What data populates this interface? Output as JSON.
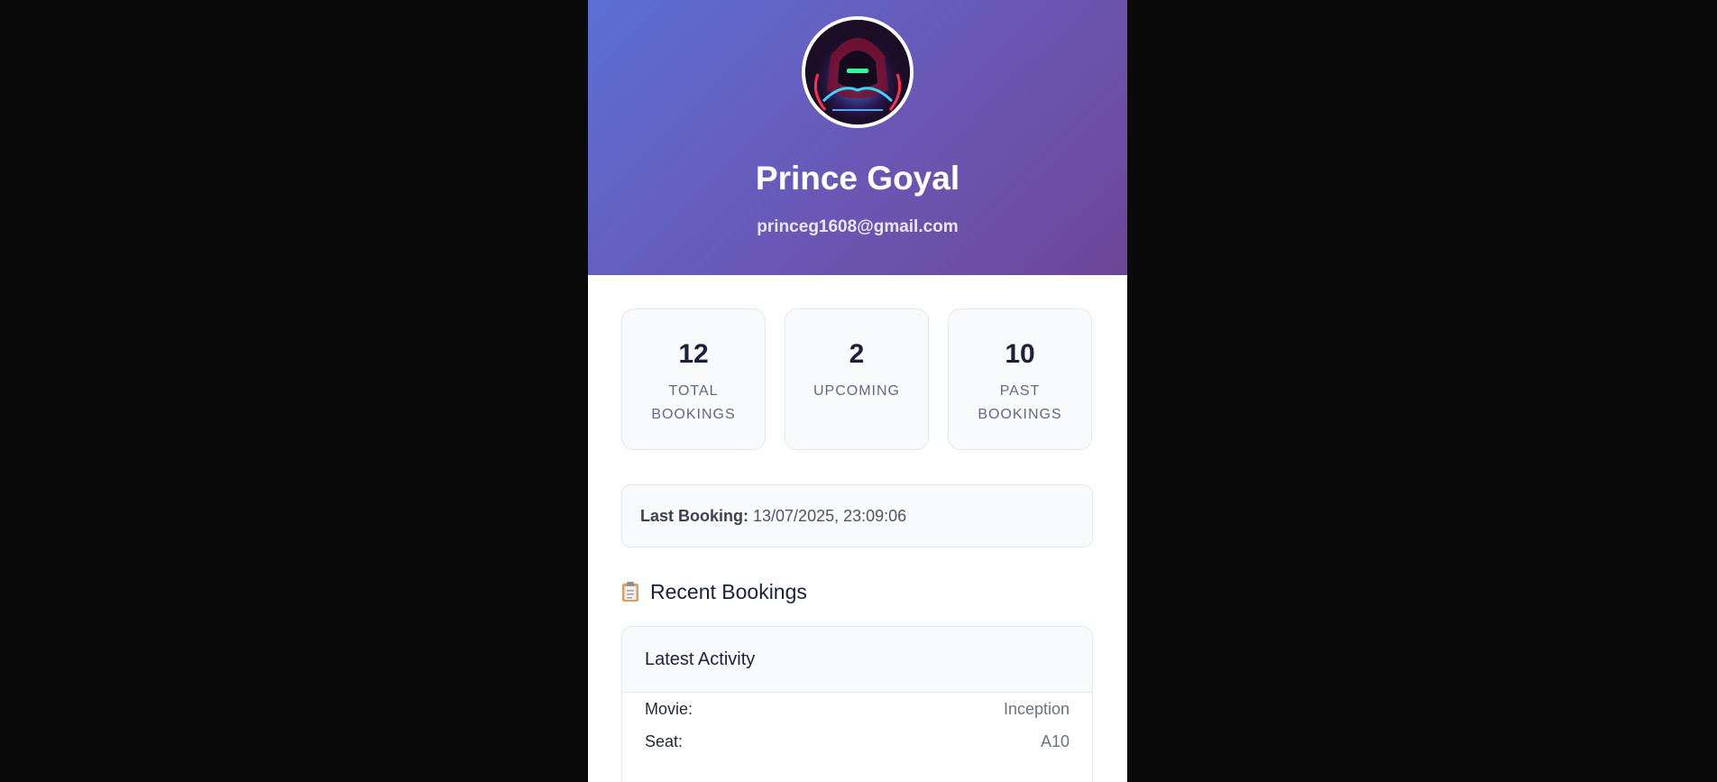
{
  "profile": {
    "name": "Prince Goyal",
    "email": "princeg1608@gmail.com",
    "avatar_icon": "avatar-image"
  },
  "stats": [
    {
      "value": "12",
      "label": "Total Bookings"
    },
    {
      "value": "2",
      "label": "Upcoming"
    },
    {
      "value": "10",
      "label": "Past Bookings"
    }
  ],
  "last_booking": {
    "label": "Last Booking:",
    "value": "13/07/2025, 23:09:06"
  },
  "recent": {
    "icon": "clipboard-icon",
    "title": "Recent Bookings",
    "card_title": "Latest Activity",
    "rows": [
      {
        "key": "Movie:",
        "value": "Inception"
      },
      {
        "key": "Seat:",
        "value": "A10"
      }
    ]
  },
  "colors": {
    "hero_start": "#5b6fd4",
    "hero_end": "#6d4697",
    "page_bg": "#0a0a0a"
  }
}
